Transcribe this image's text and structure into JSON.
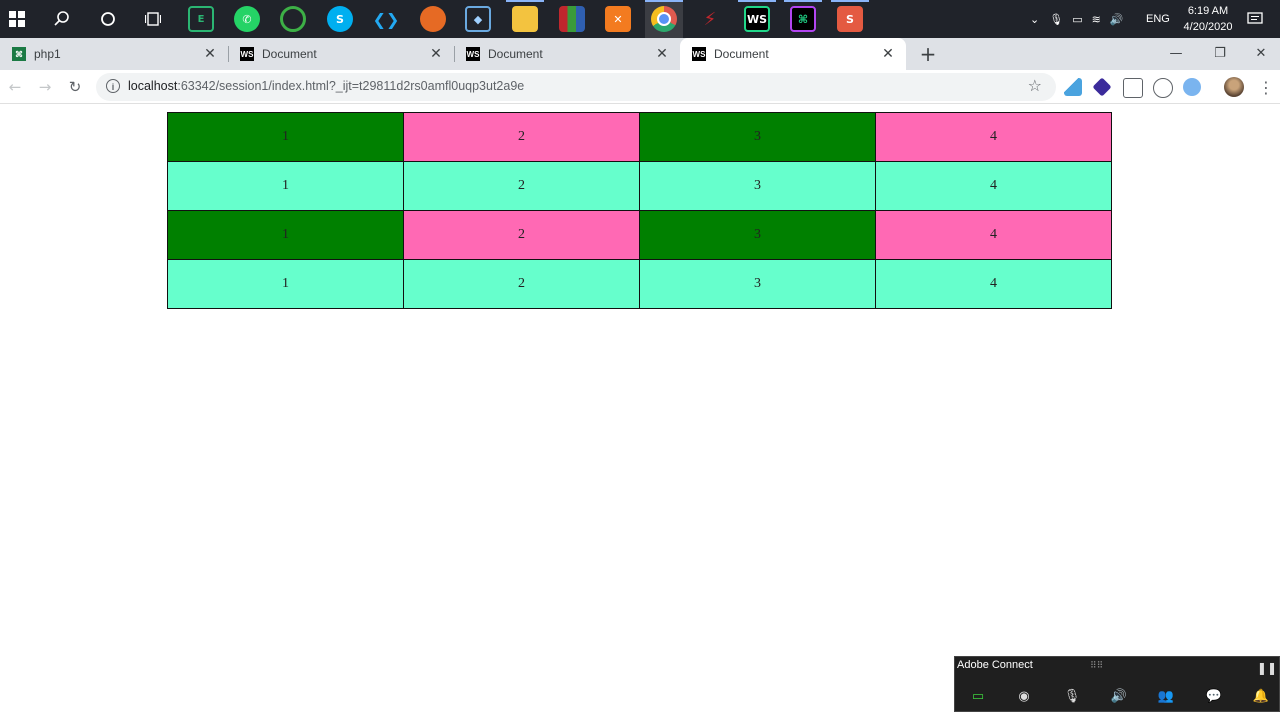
{
  "taskbar": {
    "tray": {
      "language": "ENG",
      "time": "6:19 AM",
      "date": "4/20/2020"
    }
  },
  "browser": {
    "tabs": [
      {
        "label": "php1",
        "favicon": "phpstorm-icon"
      },
      {
        "label": "Document",
        "favicon": "webstorm-icon"
      },
      {
        "label": "Document",
        "favicon": "webstorm-icon"
      },
      {
        "label": "Document",
        "favicon": "webstorm-icon",
        "active": true
      }
    ],
    "url_host": "localhost",
    "url_path": ":63342/session1/index.html?_ijt=t29811d2rs0amfl0uqp3ut2a9e"
  },
  "page": {
    "table": {
      "rows": [
        {
          "style": "alternating-green-pink",
          "cells": [
            "1",
            "2",
            "3",
            "4"
          ]
        },
        {
          "style": "aquamarine",
          "cells": [
            "1",
            "2",
            "3",
            "4"
          ]
        },
        {
          "style": "alternating-green-pink",
          "cells": [
            "1",
            "2",
            "3",
            "4"
          ]
        },
        {
          "style": "aquamarine",
          "cells": [
            "1",
            "2",
            "3",
            "4"
          ]
        }
      ],
      "colors": {
        "green": "#008000",
        "pink": "#ff69b4",
        "aquamarine": "#66ffcc"
      }
    }
  },
  "adobe_connect": {
    "title": "Adobe Connect"
  }
}
